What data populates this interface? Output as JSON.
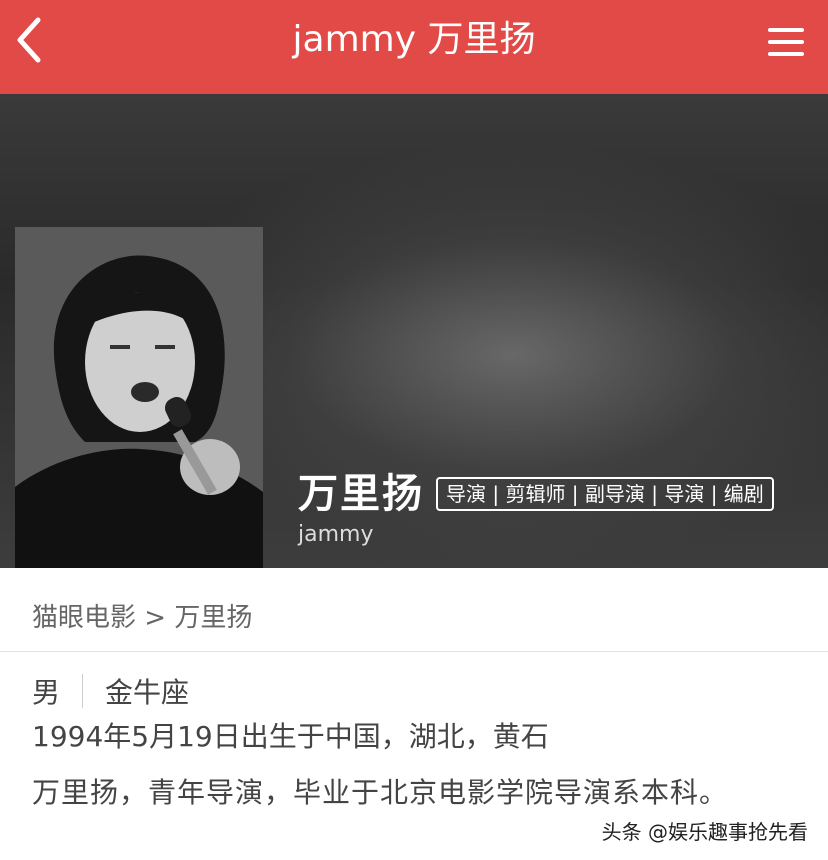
{
  "header": {
    "title": "jammy 万里扬",
    "back_icon": "chevron-left-icon",
    "menu_icon": "hamburger-menu-icon",
    "background_color": "#e24a47"
  },
  "profile": {
    "name": "万里扬",
    "roles": "导演 | 剪辑师 | 副导演 | 导演 | 编剧",
    "alias": "jammy"
  },
  "breadcrumb": {
    "root": "猫眼电影",
    "separator": " > ",
    "current": "万里扬"
  },
  "info": {
    "gender": "男",
    "zodiac": "金牛座",
    "birth": "1994年5月19日出生于中国，湖北，黄石",
    "bio": "万里扬，青年导演，毕业于北京电影学院导演系本科。"
  },
  "watermark": {
    "text": "头条 @娱乐趣事抢先看"
  }
}
